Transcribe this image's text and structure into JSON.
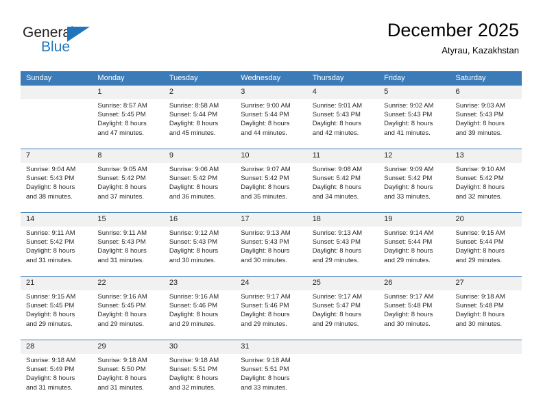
{
  "brand": {
    "name_top": "General",
    "name_bottom": "Blue",
    "triangle_color": "#1f76bd",
    "text_color": "#231f20"
  },
  "header": {
    "title": "December 2025",
    "subtitle": "Atyrau, Kazakhstan"
  },
  "theme": {
    "header_row_bg": "#3b7cb8",
    "header_row_text": "#ffffff",
    "date_band_bg": "#f1f1f1",
    "cell_bg": "#ffffff"
  },
  "weekday_headers": [
    "Sunday",
    "Monday",
    "Tuesday",
    "Wednesday",
    "Thursday",
    "Friday",
    "Saturday"
  ],
  "weeks": [
    [
      {
        "day": "",
        "lines": []
      },
      {
        "day": "1",
        "lines": [
          "Sunrise: 8:57 AM",
          "Sunset: 5:45 PM",
          "Daylight: 8 hours",
          "and 47 minutes."
        ]
      },
      {
        "day": "2",
        "lines": [
          "Sunrise: 8:58 AM",
          "Sunset: 5:44 PM",
          "Daylight: 8 hours",
          "and 45 minutes."
        ]
      },
      {
        "day": "3",
        "lines": [
          "Sunrise: 9:00 AM",
          "Sunset: 5:44 PM",
          "Daylight: 8 hours",
          "and 44 minutes."
        ]
      },
      {
        "day": "4",
        "lines": [
          "Sunrise: 9:01 AM",
          "Sunset: 5:43 PM",
          "Daylight: 8 hours",
          "and 42 minutes."
        ]
      },
      {
        "day": "5",
        "lines": [
          "Sunrise: 9:02 AM",
          "Sunset: 5:43 PM",
          "Daylight: 8 hours",
          "and 41 minutes."
        ]
      },
      {
        "day": "6",
        "lines": [
          "Sunrise: 9:03 AM",
          "Sunset: 5:43 PM",
          "Daylight: 8 hours",
          "and 39 minutes."
        ]
      }
    ],
    [
      {
        "day": "7",
        "lines": [
          "Sunrise: 9:04 AM",
          "Sunset: 5:43 PM",
          "Daylight: 8 hours",
          "and 38 minutes."
        ]
      },
      {
        "day": "8",
        "lines": [
          "Sunrise: 9:05 AM",
          "Sunset: 5:42 PM",
          "Daylight: 8 hours",
          "and 37 minutes."
        ]
      },
      {
        "day": "9",
        "lines": [
          "Sunrise: 9:06 AM",
          "Sunset: 5:42 PM",
          "Daylight: 8 hours",
          "and 36 minutes."
        ]
      },
      {
        "day": "10",
        "lines": [
          "Sunrise: 9:07 AM",
          "Sunset: 5:42 PM",
          "Daylight: 8 hours",
          "and 35 minutes."
        ]
      },
      {
        "day": "11",
        "lines": [
          "Sunrise: 9:08 AM",
          "Sunset: 5:42 PM",
          "Daylight: 8 hours",
          "and 34 minutes."
        ]
      },
      {
        "day": "12",
        "lines": [
          "Sunrise: 9:09 AM",
          "Sunset: 5:42 PM",
          "Daylight: 8 hours",
          "and 33 minutes."
        ]
      },
      {
        "day": "13",
        "lines": [
          "Sunrise: 9:10 AM",
          "Sunset: 5:42 PM",
          "Daylight: 8 hours",
          "and 32 minutes."
        ]
      }
    ],
    [
      {
        "day": "14",
        "lines": [
          "Sunrise: 9:11 AM",
          "Sunset: 5:42 PM",
          "Daylight: 8 hours",
          "and 31 minutes."
        ]
      },
      {
        "day": "15",
        "lines": [
          "Sunrise: 9:11 AM",
          "Sunset: 5:43 PM",
          "Daylight: 8 hours",
          "and 31 minutes."
        ]
      },
      {
        "day": "16",
        "lines": [
          "Sunrise: 9:12 AM",
          "Sunset: 5:43 PM",
          "Daylight: 8 hours",
          "and 30 minutes."
        ]
      },
      {
        "day": "17",
        "lines": [
          "Sunrise: 9:13 AM",
          "Sunset: 5:43 PM",
          "Daylight: 8 hours",
          "and 30 minutes."
        ]
      },
      {
        "day": "18",
        "lines": [
          "Sunrise: 9:13 AM",
          "Sunset: 5:43 PM",
          "Daylight: 8 hours",
          "and 29 minutes."
        ]
      },
      {
        "day": "19",
        "lines": [
          "Sunrise: 9:14 AM",
          "Sunset: 5:44 PM",
          "Daylight: 8 hours",
          "and 29 minutes."
        ]
      },
      {
        "day": "20",
        "lines": [
          "Sunrise: 9:15 AM",
          "Sunset: 5:44 PM",
          "Daylight: 8 hours",
          "and 29 minutes."
        ]
      }
    ],
    [
      {
        "day": "21",
        "lines": [
          "Sunrise: 9:15 AM",
          "Sunset: 5:45 PM",
          "Daylight: 8 hours",
          "and 29 minutes."
        ]
      },
      {
        "day": "22",
        "lines": [
          "Sunrise: 9:16 AM",
          "Sunset: 5:45 PM",
          "Daylight: 8 hours",
          "and 29 minutes."
        ]
      },
      {
        "day": "23",
        "lines": [
          "Sunrise: 9:16 AM",
          "Sunset: 5:46 PM",
          "Daylight: 8 hours",
          "and 29 minutes."
        ]
      },
      {
        "day": "24",
        "lines": [
          "Sunrise: 9:17 AM",
          "Sunset: 5:46 PM",
          "Daylight: 8 hours",
          "and 29 minutes."
        ]
      },
      {
        "day": "25",
        "lines": [
          "Sunrise: 9:17 AM",
          "Sunset: 5:47 PM",
          "Daylight: 8 hours",
          "and 29 minutes."
        ]
      },
      {
        "day": "26",
        "lines": [
          "Sunrise: 9:17 AM",
          "Sunset: 5:48 PM",
          "Daylight: 8 hours",
          "and 30 minutes."
        ]
      },
      {
        "day": "27",
        "lines": [
          "Sunrise: 9:18 AM",
          "Sunset: 5:48 PM",
          "Daylight: 8 hours",
          "and 30 minutes."
        ]
      }
    ],
    [
      {
        "day": "28",
        "lines": [
          "Sunrise: 9:18 AM",
          "Sunset: 5:49 PM",
          "Daylight: 8 hours",
          "and 31 minutes."
        ]
      },
      {
        "day": "29",
        "lines": [
          "Sunrise: 9:18 AM",
          "Sunset: 5:50 PM",
          "Daylight: 8 hours",
          "and 31 minutes."
        ]
      },
      {
        "day": "30",
        "lines": [
          "Sunrise: 9:18 AM",
          "Sunset: 5:51 PM",
          "Daylight: 8 hours",
          "and 32 minutes."
        ]
      },
      {
        "day": "31",
        "lines": [
          "Sunrise: 9:18 AM",
          "Sunset: 5:51 PM",
          "Daylight: 8 hours",
          "and 33 minutes."
        ]
      },
      {
        "day": "",
        "lines": []
      },
      {
        "day": "",
        "lines": []
      },
      {
        "day": "",
        "lines": []
      }
    ]
  ]
}
